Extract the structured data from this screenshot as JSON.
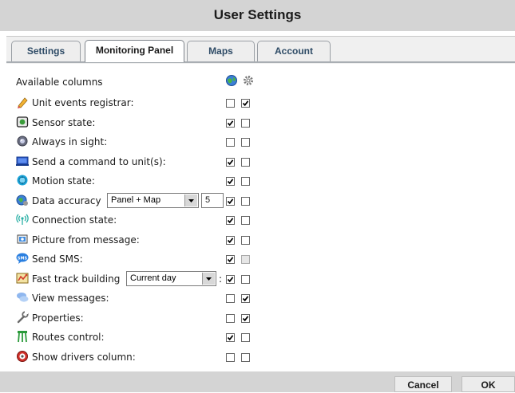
{
  "window": {
    "title": "User Settings"
  },
  "tabs": [
    {
      "label": "Settings",
      "active": false
    },
    {
      "label": "Monitoring Panel",
      "active": true
    },
    {
      "label": "Maps",
      "active": false
    },
    {
      "label": "Account",
      "active": false
    }
  ],
  "header": {
    "label": "Available columns",
    "icons": [
      "globe-icon",
      "gear-icon"
    ]
  },
  "rows": [
    {
      "label": "Unit events registrar:",
      "icon": "pencil-icon",
      "check_a": false,
      "check_b": true
    },
    {
      "label": "Sensor state:",
      "icon": "sensor-icon",
      "check_a": true,
      "check_b": false
    },
    {
      "label": "Always in sight:",
      "icon": "eye-icon",
      "check_a": false,
      "check_b": false
    },
    {
      "label": "Send a command to unit(s):",
      "icon": "terminal-icon",
      "check_a": true,
      "check_b": false
    },
    {
      "label": "Motion state:",
      "icon": "motion-icon",
      "check_a": true,
      "check_b": false
    },
    {
      "label": "Data accuracy",
      "icon": "satellite-icon",
      "check_a": true,
      "check_b": false,
      "select_value": "Panel + Map",
      "number_value": "5"
    },
    {
      "label": "Connection state:",
      "icon": "signal-icon",
      "check_a": true,
      "check_b": false
    },
    {
      "label": "Picture from message:",
      "icon": "camera-icon",
      "check_a": true,
      "check_b": false
    },
    {
      "label": "Send SMS:",
      "icon": "sms-icon",
      "check_a": true,
      "check_b": false,
      "b_disabled": true
    },
    {
      "label": "Fast track building",
      "icon": "track-icon",
      "check_a": true,
      "check_b": false,
      "select_value": "Current day",
      "suffix": ":"
    },
    {
      "label": "View messages:",
      "icon": "messages-icon",
      "check_a": false,
      "check_b": true
    },
    {
      "label": "Properties:",
      "icon": "wrench-icon",
      "check_a": false,
      "check_b": true
    },
    {
      "label": "Routes control:",
      "icon": "routes-icon",
      "check_a": true,
      "check_b": false
    },
    {
      "label": "Show drivers column:",
      "icon": "steering-wheel-icon",
      "check_a": false,
      "check_b": false
    }
  ],
  "buttons": {
    "cancel": "Cancel",
    "ok": "OK"
  }
}
